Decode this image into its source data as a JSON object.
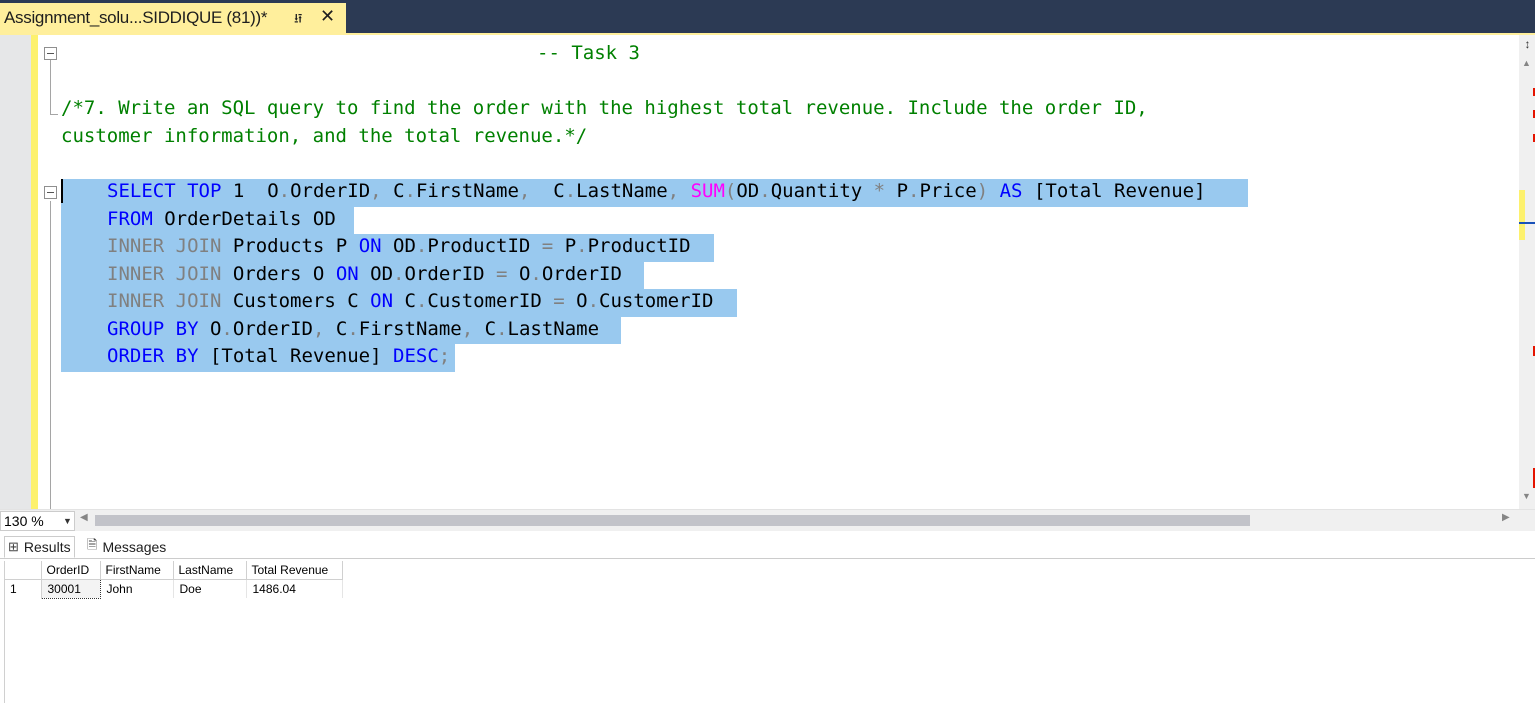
{
  "tab": {
    "title": "Assignment_solu...SIDDIQUE (81))*",
    "pin_icon": "pin-icon",
    "close_icon": "close-icon"
  },
  "editor": {
    "task_comment": "-- Task 3",
    "question_line1": "/*7. Write an SQL query to find the order with the highest total revenue. Include the order ID,",
    "question_line2": "customer information, and the total revenue.*/",
    "sql": {
      "l1": {
        "kw1": "SELECT",
        "kw2": "TOP",
        "t1": "1  O",
        "d1": ".",
        "t2": "OrderID",
        "c1": ",",
        "t3": " C",
        "d2": ".",
        "t4": "FirstName",
        "c2": ",",
        "t5": "  C",
        "d3": ".",
        "t6": "LastName",
        "c3": ",",
        "fn": "SUM",
        "p1": "(",
        "t7": "OD",
        "d4": ".",
        "t8": "Quantity",
        "op": "*",
        "t9": "P",
        "d5": ".",
        "t10": "Price",
        "p2": ")",
        "kw3": "AS",
        "t11": "[Total Revenue]"
      },
      "l2": {
        "kw1": "FROM",
        "t1": "OrderDetails OD"
      },
      "l3": {
        "g1": "INNER JOIN",
        "t1": "Products P",
        "kw1": "ON",
        "t2": "OD",
        "d1": ".",
        "t3": "ProductID",
        "eq": "=",
        "t4": "P",
        "d2": ".",
        "t5": "ProductID"
      },
      "l4": {
        "g1": "INNER JOIN",
        "t1": "Orders O",
        "kw1": "ON",
        "t2": "OD",
        "d1": ".",
        "t3": "OrderID",
        "eq": "=",
        "t4": "O",
        "d2": ".",
        "t5": "OrderID"
      },
      "l5": {
        "g1": "INNER JOIN",
        "t1": "Customers C",
        "kw1": "ON",
        "t2": "C",
        "d1": ".",
        "t3": "CustomerID",
        "eq": "=",
        "t4": "O",
        "d2": ".",
        "t5": "CustomerID"
      },
      "l6": {
        "kw1": "GROUP BY",
        "t1": "O",
        "d1": ".",
        "t2": "OrderID",
        "c1": ",",
        "t3": "C",
        "d2": ".",
        "t4": "FirstName",
        "c2": ",",
        "t5": "C",
        "d3": ".",
        "t6": "LastName"
      },
      "l7": {
        "kw1": "ORDER BY",
        "t1": "[Total Revenue]",
        "kw2": "DESC",
        "sc": ";"
      }
    }
  },
  "zoom": {
    "value": "130 %"
  },
  "results_tabs": [
    {
      "label": "Results",
      "icon": "grid-icon"
    },
    {
      "label": "Messages",
      "icon": "messages-icon"
    }
  ],
  "grid": {
    "columns": [
      "OrderID",
      "FirstName",
      "LastName",
      "Total Revenue"
    ],
    "rows": [
      {
        "num": "1",
        "cells": [
          "30001",
          "John",
          "Doe",
          "1486.04"
        ]
      }
    ]
  },
  "colors": {
    "tab_bg": "#ffef9c",
    "titlebar": "#2c3a54",
    "selection": "#99c9ef",
    "keyword": "#0000ff",
    "comment": "#008000",
    "function": "#ff00ff"
  }
}
